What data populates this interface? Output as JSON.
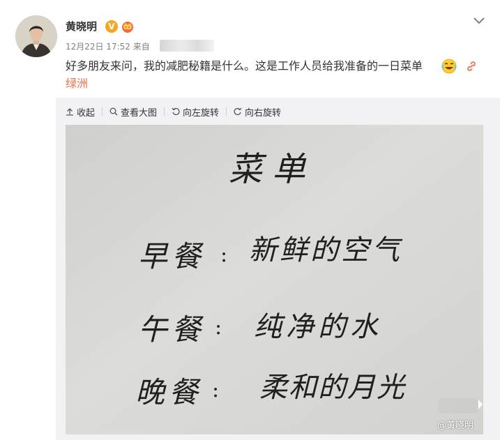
{
  "post": {
    "author": {
      "name": "黄晓明",
      "verified_badge": "V",
      "avatar_icon": "person-avatar",
      "member_badge_icon": "member-crown-icon"
    },
    "meta": {
      "time": "12月22日 17:52",
      "source_prefix": "来自"
    },
    "text": "好多朋友来问，我的减肥秘籍是什么。这是工作人员给我准备的一日菜单",
    "emoji_icon": "laugh-cry-emoji",
    "link_icon": "link-icon",
    "link_text": "绿洲",
    "menu_icon": "chevron-down-icon"
  },
  "media": {
    "toolbar": {
      "collapse": "收起",
      "view_large": "查看大图",
      "rotate_left": "向左旋转",
      "rotate_right": "向右旋转"
    },
    "watermark": "@黄晓明",
    "handwritten_menu": {
      "title": "菜单",
      "lines": [
        {
          "meal": "早餐",
          "dish": "新鲜的空气"
        },
        {
          "meal": "午餐",
          "dish": "纯净的水"
        },
        {
          "meal": "晚餐",
          "dish": "柔和的月光"
        }
      ]
    }
  },
  "colors": {
    "link": "#eb7350",
    "badge": "#f5a623",
    "paper": "#d8d8d4"
  }
}
